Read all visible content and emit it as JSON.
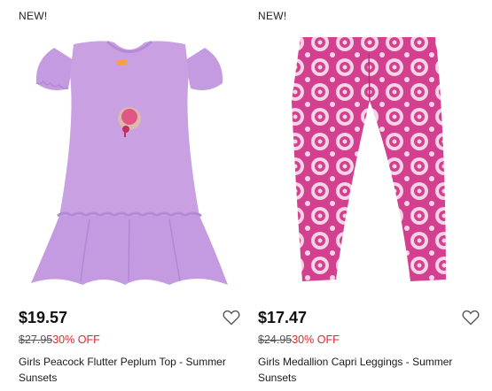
{
  "products": [
    {
      "badge": "NEW!",
      "price": "$19.57",
      "original_price": "$27.95",
      "discount": "30% OFF",
      "name": "Girls Peacock Flutter Peplum Top - Summer Sunsets",
      "image_color": "#c9a0e2",
      "icon": "heart-outline-icon"
    },
    {
      "badge": "NEW!",
      "price": "$17.47",
      "original_price": "$24.95",
      "discount": "30% OFF",
      "name": "Girls Medallion Capri Leggings - Summer Sunsets",
      "image_color": "#d2408f",
      "icon": "heart-outline-icon"
    }
  ],
  "colors": {
    "discount": "#e4262b",
    "text": "#1a1a1a"
  }
}
